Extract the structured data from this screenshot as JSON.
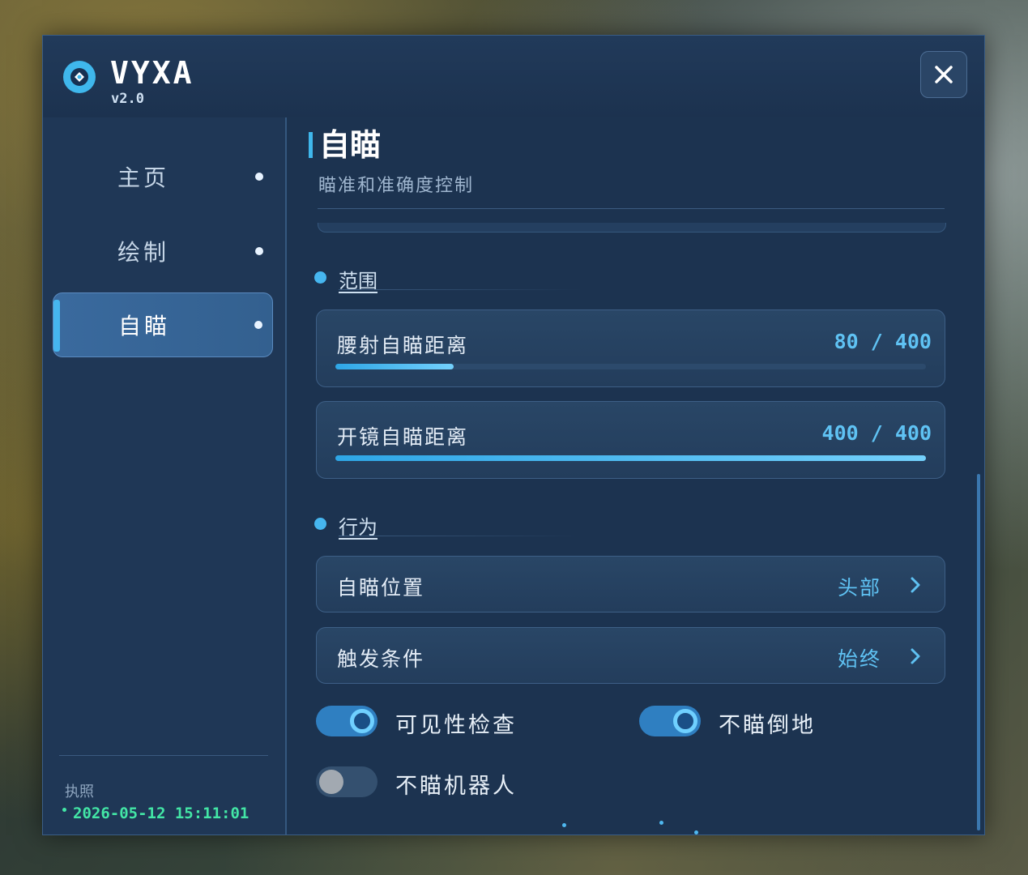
{
  "app": {
    "title": "VYXA",
    "version": "v2.0"
  },
  "header": {
    "close_icon": "close-icon"
  },
  "sidebar": {
    "items": [
      {
        "label": "主页",
        "active": false
      },
      {
        "label": "绘制",
        "active": false
      },
      {
        "label": "自瞄",
        "active": true
      }
    ],
    "license_label": "执照",
    "license_time": "2026-05-12 15:11:01"
  },
  "page": {
    "title": "自瞄",
    "subtitle": "瞄准和准确度控制"
  },
  "sections": {
    "range": {
      "label": "范围"
    },
    "behavior": {
      "label": "行为"
    }
  },
  "sliders": [
    {
      "label": "腰射自瞄距离",
      "value": 80,
      "max": 400,
      "display": "80 / 400"
    },
    {
      "label": "开镜自瞄距离",
      "value": 400,
      "max": 400,
      "display": "400 / 400"
    }
  ],
  "selects": [
    {
      "label": "自瞄位置",
      "value": "头部"
    },
    {
      "label": "触发条件",
      "value": "始终"
    }
  ],
  "toggles": [
    {
      "label": "可见性检查",
      "on": true
    },
    {
      "label": "不瞄倒地",
      "on": true
    },
    {
      "label": "不瞄机器人",
      "on": false
    }
  ],
  "colors": {
    "accent": "#46b6ef",
    "panel": "#1e3552",
    "license_green": "#43e6a6"
  }
}
